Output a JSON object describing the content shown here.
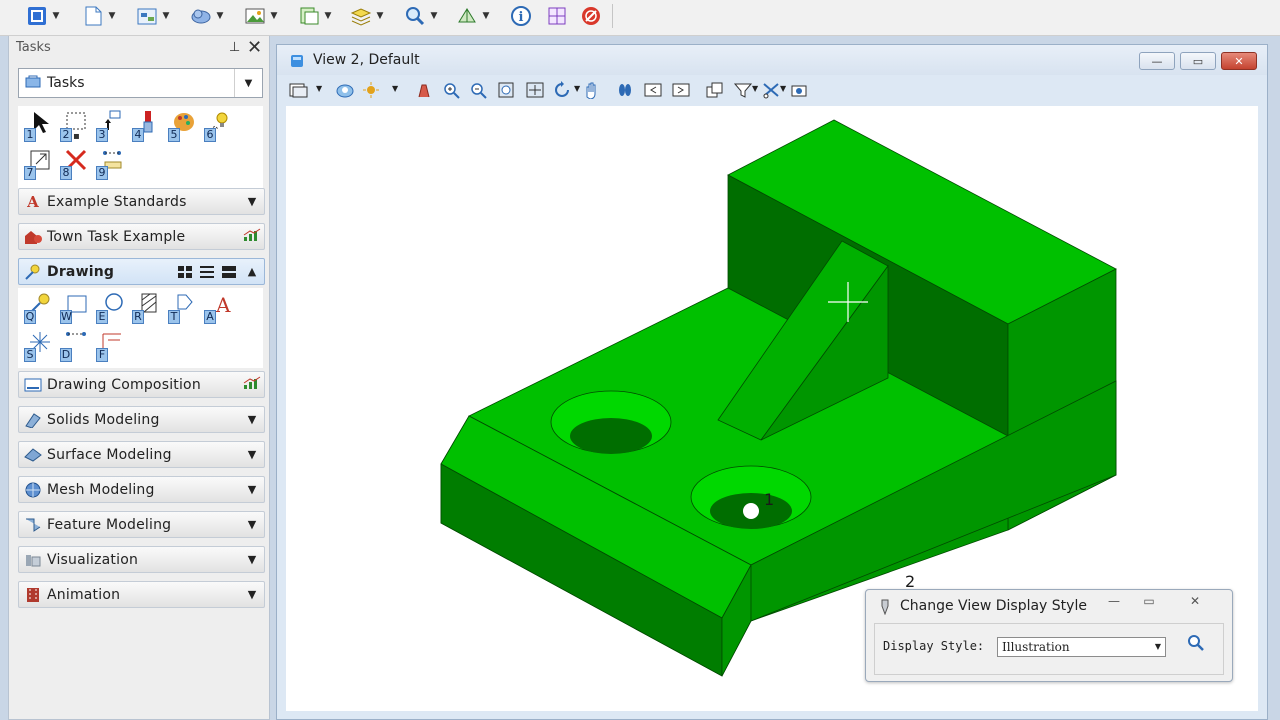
{
  "tasks_panel": {
    "title": "Tasks",
    "pin_glyph": "⊥",
    "close_glyph": "✕",
    "dropdown_label": "Tasks",
    "general_tools": [
      "1",
      "2",
      "3",
      "4",
      "5",
      "6",
      "7",
      "8",
      "9"
    ],
    "rows": [
      {
        "label": "Example Standards",
        "icon": "letter-a-icon",
        "chevron": "⌄"
      },
      {
        "label": "Town Task Example",
        "icon": "town-icon",
        "chevron": "chart"
      },
      {
        "label": "Drawing",
        "icon": "drawing-icon",
        "chevron": "⌃"
      },
      {
        "label": "Drawing Composition",
        "icon": "sheet-icon",
        "chevron": "chart"
      },
      {
        "label": "Solids Modeling",
        "icon": "solid-icon",
        "chevron": "⌄"
      },
      {
        "label": "Surface Modeling",
        "icon": "surface-icon",
        "chevron": "⌄"
      },
      {
        "label": "Mesh Modeling",
        "icon": "mesh-icon",
        "chevron": "⌄"
      },
      {
        "label": "Feature Modeling",
        "icon": "feature-icon",
        "chevron": "⌄"
      },
      {
        "label": "Visualization",
        "icon": "visualization-icon",
        "chevron": "⌄"
      },
      {
        "label": "Animation",
        "icon": "film-icon",
        "chevron": "⌄"
      }
    ],
    "drawing_tools": [
      "Q",
      "W",
      "E",
      "R",
      "T",
      "A",
      "S",
      "D",
      "F"
    ]
  },
  "view": {
    "title": "View 2, Default",
    "min_glyph": "—",
    "max_glyph": "▭",
    "close_glyph": "✕"
  },
  "viewport": {
    "label_1": "1",
    "label_2": "2"
  },
  "dialog": {
    "title": "Change View Display Style",
    "label": "Display Style:",
    "value": "Illustration",
    "min_glyph": "—",
    "max_glyph": "▭",
    "close_glyph": "✕"
  },
  "colors": {
    "model_top": "#00c000",
    "model_side": "#009600",
    "model_dark": "#006e00"
  }
}
